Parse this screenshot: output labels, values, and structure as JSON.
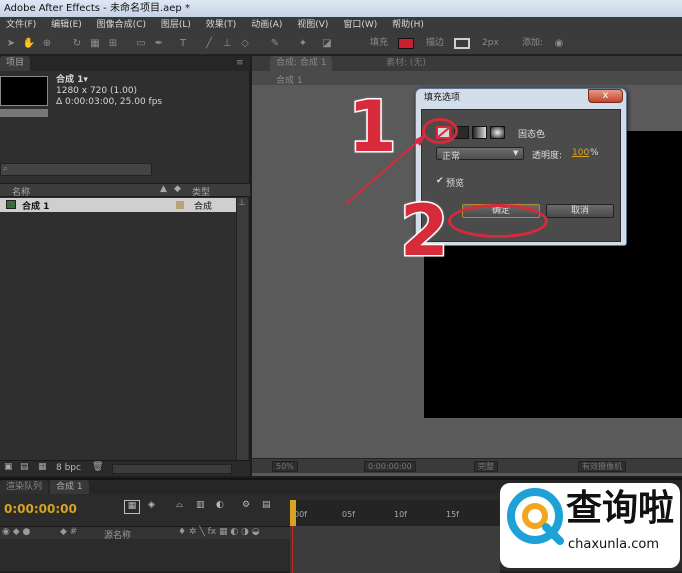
{
  "window": {
    "title": "Adobe After Effects - 未命名项目.aep *"
  },
  "menu": [
    "文件(F)",
    "编辑(E)",
    "图像合成(C)",
    "图层(L)",
    "效果(T)",
    "动画(A)",
    "视图(V)",
    "窗口(W)",
    "帮助(H)"
  ],
  "toolbar": {
    "fill_label": "填充",
    "stroke_label": "描边",
    "stroke_width": "2px",
    "add_label": "添加:"
  },
  "project_panel": {
    "tab": "项目",
    "comp_name": "合成 1▾",
    "comp_size": "1280 x 720 (1.00)",
    "comp_duration": "Δ 0:00:03:00, 25.00 fps",
    "col_name": "名称",
    "col_type": "类型",
    "rows": [
      {
        "name": "合成 1",
        "type": "合成"
      }
    ],
    "bpc": "8 bpc"
  },
  "comp_panel": {
    "tab": "合成: 合成 1",
    "tab2": "素材: (无)",
    "breadcrumb": "合成 1",
    "zoom": "50%",
    "time": "0:00:00:00",
    "quality": "完整",
    "camera": "有效摄像机"
  },
  "timeline": {
    "tab1": "渲染队列",
    "tab2": "合成 1",
    "time": "0:00:00:00",
    "col_source": "源名称",
    "ticks": [
      "00f",
      "05f",
      "10f",
      "15f"
    ]
  },
  "dialog": {
    "title": "填充选项",
    "close": "x",
    "fill_type": "固态色",
    "blend_mode": "正常",
    "opacity_label": "透明度:",
    "opacity_value": "100",
    "opacity_unit": "%",
    "preview_label": "预览",
    "preview_checked": true,
    "ok": "确定",
    "cancel": "取消"
  },
  "annotations": {
    "step1": "1",
    "step2": "2"
  },
  "watermark": {
    "brand": "查询啦",
    "site": "chaxunla.com"
  },
  "colors": {
    "accent_red": "#d72a3a",
    "fill_swatch": "#c8202f",
    "timecode": "#d9a321",
    "opacity_value": "#d9a321"
  }
}
